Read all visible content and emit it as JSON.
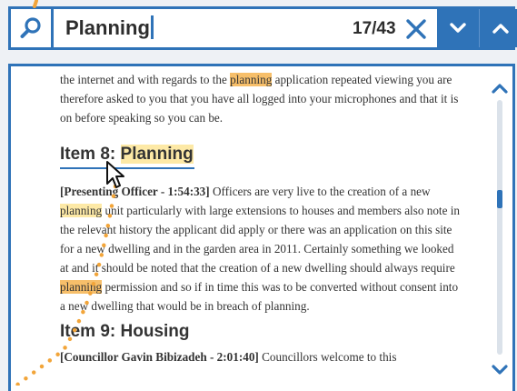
{
  "search": {
    "query": "Planning",
    "counter": "17/43",
    "icon": "search-icon",
    "clear_icon": "close-icon",
    "next_icon": "chevron-down-icon",
    "prev_icon": "chevron-up-icon"
  },
  "transcript": {
    "intro_part1": "the internet and with regards to the ",
    "intro_highlight": "planning",
    "intro_part2": " application repeated viewing you are therefore asked to you that you have all logged into your microphones and that it is on before speaking so you can be.",
    "item8_prefix": "Item 8: ",
    "item8_highlight": "Planning",
    "para2_speaker": "[Presenting Officer - 1:54:33]",
    "para2_part1": " Officers are very live to the creation of a new ",
    "para2_highlight1": "planning",
    "para2_part2": " unit particularly with large extensions to houses and members also note in the relevant history the applicant did apply or there was an application on this site for a new dwelling and in the garden area in 2011. Certainly something we looked at and it should be noted that the creation of a new dwelling should always require ",
    "para2_highlight2": "planning",
    "para2_part3": " permission and so if in time this was to be converted without consent into a new dwelling that would be in breach of planning.",
    "item9": "Item 9: Housing",
    "para3_speaker": "[Councillor Gavin Bibizadeh - 2:01:40]",
    "para3_text": " Councillors welcome to this"
  },
  "scrollbar": {
    "up_icon": "chevron-up-icon",
    "down_icon": "chevron-down-icon",
    "position": 0.38
  },
  "colors": {
    "accent": "#2f73b8",
    "highlight": "#fde9a6",
    "current_highlight": "#f7bf6a",
    "trail": "#f2a53a"
  }
}
